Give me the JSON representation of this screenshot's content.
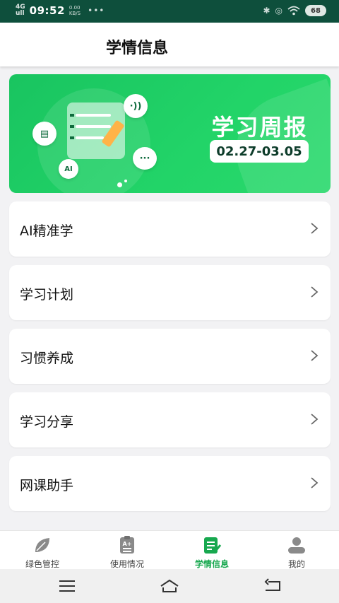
{
  "status_bar": {
    "network": "4G",
    "signal": "ull",
    "time": "09:52",
    "speed_value": "0.00",
    "speed_unit": "KB/S",
    "more": "•••",
    "battery": "68"
  },
  "header": {
    "title": "学情信息"
  },
  "banner": {
    "title": "学习周报",
    "date_range": "02.27-03.05"
  },
  "menu": [
    {
      "label": "AI精准学"
    },
    {
      "label": "学习计划"
    },
    {
      "label": "习惯养成"
    },
    {
      "label": "学习分享"
    },
    {
      "label": "网课助手"
    }
  ],
  "tabs": [
    {
      "label": "绿色管控",
      "icon": "leaf-icon",
      "active": false
    },
    {
      "label": "使用情况",
      "icon": "clipboard-a-icon",
      "active": false
    },
    {
      "label": "学情信息",
      "icon": "document-pencil-icon",
      "active": true
    },
    {
      "label": "我的",
      "icon": "user-icon",
      "active": false
    }
  ],
  "colors": {
    "status_bar_bg": "#0e4f3c",
    "accent_green": "#17a84f",
    "banner_green": "#22d468",
    "inactive_icon": "#8a8a8a"
  }
}
